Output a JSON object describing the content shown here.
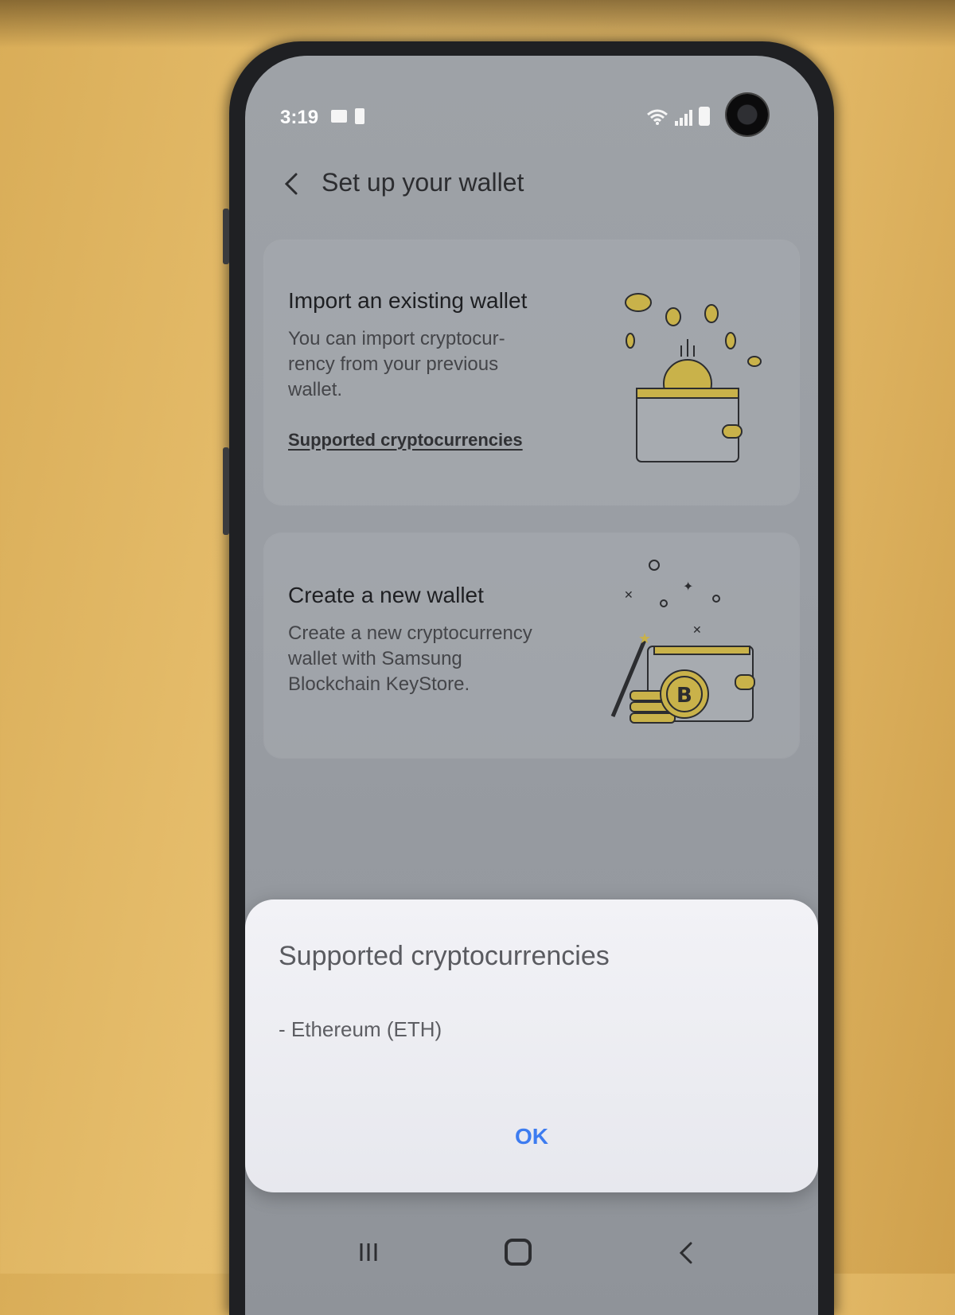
{
  "status_bar": {
    "time": "3:19"
  },
  "header": {
    "title": "Set up your wallet"
  },
  "import_card": {
    "title": "Import an existing wallet",
    "description": "You can import cryptocur-\nrency from your previous\nwallet.",
    "link": "Supported cryptocurrencies"
  },
  "create_card": {
    "title": "Create a new wallet",
    "description": "Create a new cryptocurrency\nwallet with Samsung\nBlockchain KeyStore."
  },
  "dialog": {
    "title": "Supported cryptocurrencies",
    "body": "- Ethereum (ETH)",
    "ok_label": "OK"
  },
  "colors": {
    "accent": "#3d7cf0",
    "illustration_gold": "#c9b24a"
  }
}
